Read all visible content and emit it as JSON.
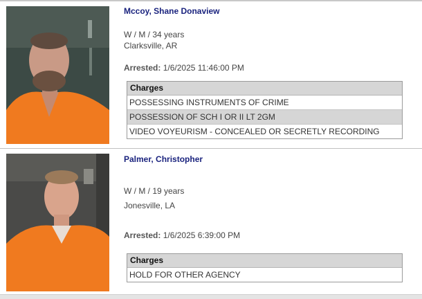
{
  "records": [
    {
      "name": "Mccoy, Shane Donaview",
      "demographics": "W / M / 34 years",
      "location": "Clarksville, AR",
      "arrested_label": "Arrested:",
      "arrested_value": "1/6/2025 11:46:00 PM",
      "charges_header": "Charges",
      "charges": [
        "POSSESSING INSTRUMENTS OF CRIME",
        "POSSESSION OF SCH I OR II LT 2GM",
        "VIDEO VOYEURISM - CONCEALED OR SECRETLY RECORDING"
      ]
    },
    {
      "name": "Palmer, Christopher",
      "demographics": "W / M / 19 years",
      "location": "Jonesville, LA",
      "arrested_label": "Arrested:",
      "arrested_value": "1/6/2025 6:39:00 PM",
      "charges_header": "Charges",
      "charges": [
        "HOLD FOR OTHER AGENCY"
      ]
    }
  ],
  "colors": {
    "name": "#1a237e",
    "charges_header_bg": "#d6d6d6",
    "uniform": "#f07a1f"
  }
}
